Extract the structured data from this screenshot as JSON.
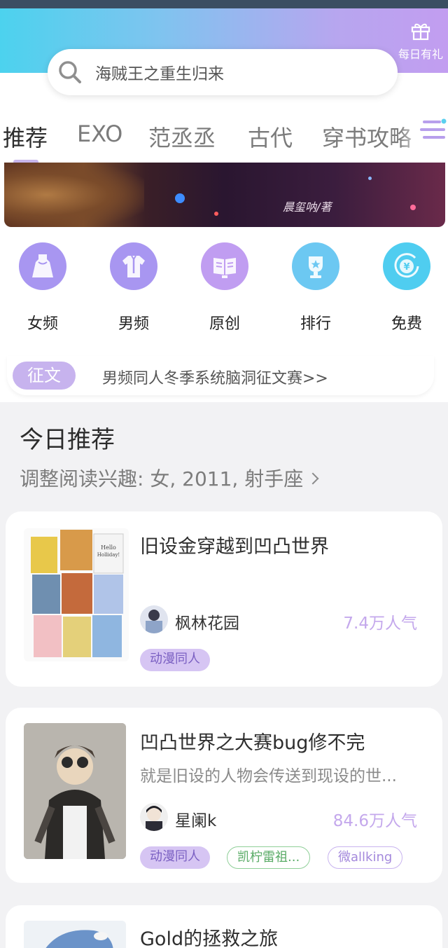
{
  "header": {
    "gift_label": "每日有礼",
    "search_placeholder": "海贼王之重生归来"
  },
  "tabs": [
    {
      "label": "推荐",
      "active": true
    },
    {
      "label": "EXO",
      "active": false
    },
    {
      "label": "范丞丞",
      "active": false
    },
    {
      "label": "古代",
      "active": false
    },
    {
      "label": "穿书攻略",
      "active": false
    }
  ],
  "banner": {
    "author": "晨玺呐/著"
  },
  "categories": [
    {
      "label": "女频",
      "icon": "dress-icon",
      "color": "#a896f1"
    },
    {
      "label": "男频",
      "icon": "shirt-icon",
      "color": "#a896f1"
    },
    {
      "label": "原创",
      "icon": "book-icon",
      "color": "#c09df1"
    },
    {
      "label": "排行",
      "icon": "trophy-icon",
      "color": "#6cc8f2"
    },
    {
      "label": "免费",
      "icon": "yuan-coin-icon",
      "color": "#4fcdf0"
    }
  ],
  "contest": {
    "badge": "征文",
    "text": "男频同人冬季系统脑洞征文赛>>"
  },
  "today": {
    "title": "今日推荐",
    "interest": "调整阅读兴趣: 女, 2011, 射手座"
  },
  "books": [
    {
      "title": "旧设金穿越到凹凸世界",
      "description": "",
      "author": "枫林花园",
      "popularity": "7.4万人气",
      "tags": [
        "动漫同人"
      ]
    },
    {
      "title": "凹凸世界之大赛bug修不完",
      "description": "就是旧设的人物会传送到现设的世...",
      "author": "星阑k",
      "popularity": "84.6万人气",
      "tags": [
        "动漫同人",
        "凯柠雷祖...",
        "微allking"
      ]
    },
    {
      "title": "Gold的拯救之旅",
      "description": "",
      "author": "",
      "popularity": "",
      "tags": []
    }
  ],
  "colors": {
    "accent": "#c7b3ee",
    "popularity": "#c4a8ec",
    "header_gradient_start": "#4cd2ee",
    "header_gradient_end": "#c29df0"
  }
}
